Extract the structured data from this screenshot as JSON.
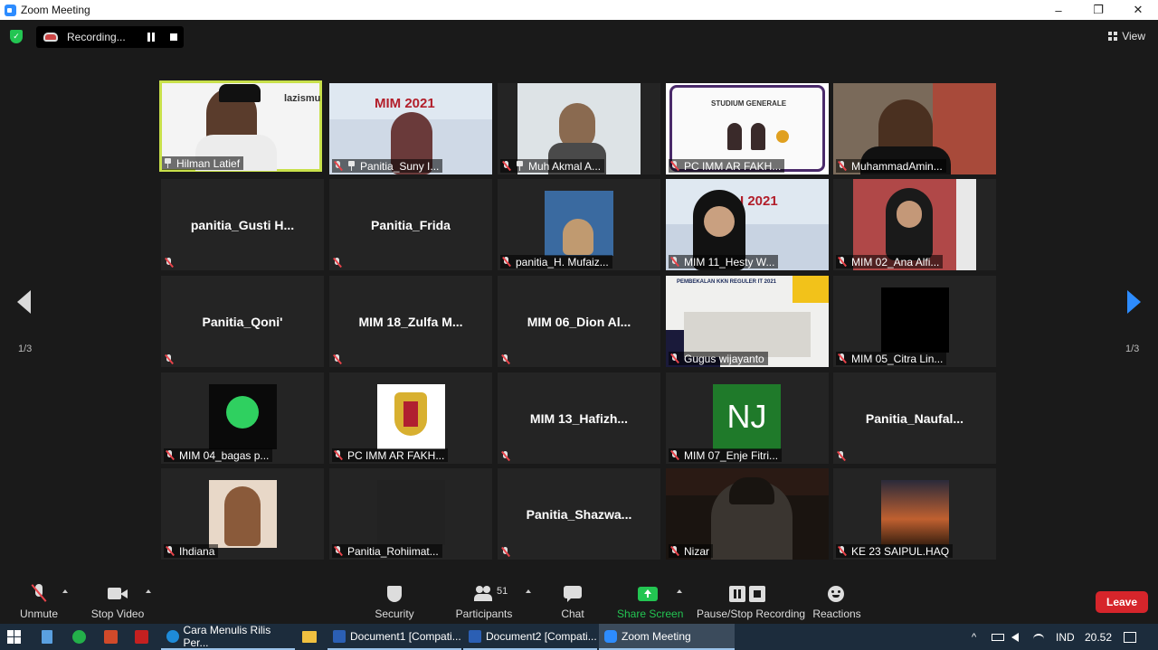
{
  "window": {
    "title": "Zoom Meeting",
    "controls": [
      "–",
      "❐",
      "✕"
    ]
  },
  "recording": {
    "label": "Recording..."
  },
  "view_label": "View",
  "pagination": {
    "left": "1/3",
    "right": "1/3"
  },
  "participants": [
    {
      "label": "Hilman Latief",
      "icon": "pin",
      "active": true
    },
    {
      "label": "Panitia_Suny I...",
      "icon": "mic-pin"
    },
    {
      "label": "Muh Akmal A...",
      "icon": "mic-pin"
    },
    {
      "label": "PC IMM AR FAKH...",
      "icon": "mic"
    },
    {
      "label": "MuhammadAmin...",
      "icon": "mic"
    },
    {
      "center_name": "panitia_Gusti  H...",
      "icon": "mic"
    },
    {
      "center_name": "Panitia_Frida",
      "icon": "mic"
    },
    {
      "label": "panitia_H. Mufaiz...",
      "icon": "mic"
    },
    {
      "label": "MIM 11_Hesty W...",
      "icon": "mic"
    },
    {
      "label": "MIM 02_Ana Alfi...",
      "icon": "mic"
    },
    {
      "center_name": "Panitia_Qoni'",
      "icon": "mic"
    },
    {
      "center_name": "MIM  18_Zulfa  M...",
      "icon": "mic"
    },
    {
      "center_name": "MIM  06_Dion  Al...",
      "icon": "mic"
    },
    {
      "label": "Gugus wijayanto",
      "icon": "mic"
    },
    {
      "label": "MIM 05_Citra Lin...",
      "icon": "mic"
    },
    {
      "label": "MIM 04_bagas p...",
      "icon": "mic"
    },
    {
      "label": "PC IMM AR FAKH...",
      "icon": "mic"
    },
    {
      "center_name": "MIM  13_Hafizh...",
      "icon": "mic"
    },
    {
      "label": "MIM 07_Enje Fitri...",
      "icon": "mic",
      "initials": "NJ"
    },
    {
      "center_name": "Panitia_Naufal...",
      "icon": "mic"
    },
    {
      "label": "Ihdiana",
      "icon": "mic"
    },
    {
      "label": "Panitia_Rohiimat...",
      "icon": "mic"
    },
    {
      "center_name": "Panitia_Shazwa...",
      "icon": "mic"
    },
    {
      "label": "Nizar",
      "icon": "mic"
    },
    {
      "label": "KE 23 SAIPUL.HAQ",
      "icon": "mic"
    }
  ],
  "tile_texts": {
    "lazismu": "lazismu",
    "mim_2021": "MIM 2021",
    "mim_2021_partial": "I 2021",
    "studium_generale": "STUDIUM GENERALE",
    "pembekalan": "PEMBEKALAN KKN REGULER IT 2021"
  },
  "toolbar": {
    "unmute": "Unmute",
    "stop_video": "Stop Video",
    "security": "Security",
    "participants": "Participants",
    "participants_count": "51",
    "chat": "Chat",
    "share_screen": "Share Screen",
    "pause_stop_recording": "Pause/Stop Recording",
    "reactions": "Reactions",
    "leave": "Leave"
  },
  "taskbar": {
    "apps": [
      {
        "label": "Cara Menulis Rilis Per...",
        "color": "#1e8bd9"
      },
      {
        "label": "Document1 [Compati...",
        "color": "#2b5fb4"
      },
      {
        "label": "Document2 [Compati...",
        "color": "#2b5fb4"
      },
      {
        "label": "Zoom Meeting",
        "color": "#2d8cff"
      }
    ],
    "lang": "IND",
    "time": "20.52"
  },
  "colors": {
    "accent": "#2d8cff",
    "active_speaker": "#c8e04a",
    "share": "#23c552",
    "leave": "#d6252b"
  }
}
